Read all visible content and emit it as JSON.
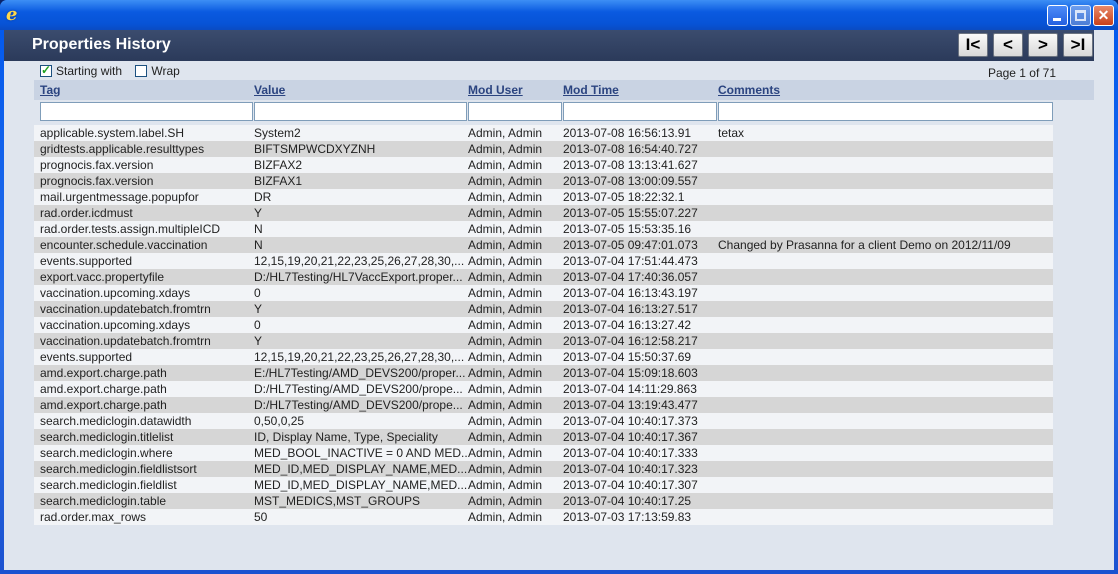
{
  "window": {
    "icon": "ie-icon"
  },
  "header": {
    "title": "Properties History"
  },
  "nav": {
    "first": "I<",
    "prev": "<",
    "next": ">",
    "last": ">I"
  },
  "options": {
    "starting_with": {
      "label": "Starting with",
      "checked": true
    },
    "wrap": {
      "label": "Wrap",
      "checked": false
    },
    "page_indicator": "Page 1 of 71"
  },
  "columns": [
    "Tag",
    "Value",
    "Mod User",
    "Mod Time",
    "Comments"
  ],
  "filters": {
    "tag": "",
    "value": "",
    "mod_user": "",
    "mod_time": "",
    "comments": ""
  },
  "rows": [
    {
      "tag": "applicable.system.label.SH",
      "value": "System2",
      "user": "Admin, Admin",
      "time": "2013-07-08 16:56:13.91",
      "comment": "tetax"
    },
    {
      "tag": "gridtests.applicable.resulttypes",
      "value": "BIFTSMPWCDXYZNH",
      "user": "Admin, Admin",
      "time": "2013-07-08 16:54:40.727",
      "comment": ""
    },
    {
      "tag": "prognocis.fax.version",
      "value": "BIZFAX2",
      "user": "Admin, Admin",
      "time": "2013-07-08 13:13:41.627",
      "comment": ""
    },
    {
      "tag": "prognocis.fax.version",
      "value": "BIZFAX1",
      "user": "Admin, Admin",
      "time": "2013-07-08 13:00:09.557",
      "comment": ""
    },
    {
      "tag": "mail.urgentmessage.popupfor",
      "value": "DR",
      "user": "Admin, Admin",
      "time": "2013-07-05 18:22:32.1",
      "comment": ""
    },
    {
      "tag": "rad.order.icdmust",
      "value": "Y",
      "user": "Admin, Admin",
      "time": "2013-07-05 15:55:07.227",
      "comment": ""
    },
    {
      "tag": "rad.order.tests.assign.multipleICD",
      "value": "N",
      "user": "Admin, Admin",
      "time": "2013-07-05 15:53:35.16",
      "comment": ""
    },
    {
      "tag": "encounter.schedule.vaccination",
      "value": "N",
      "user": "Admin, Admin",
      "time": "2013-07-05 09:47:01.073",
      "comment": "Changed by Prasanna for a client Demo on 2012/11/09"
    },
    {
      "tag": "events.supported",
      "value": "12,15,19,20,21,22,23,25,26,27,28,30,...",
      "user": "Admin, Admin",
      "time": "2013-07-04 17:51:44.473",
      "comment": ""
    },
    {
      "tag": "export.vacc.propertyfile",
      "value": "D:/HL7Testing/HL7VaccExport.proper...",
      "user": "Admin, Admin",
      "time": "2013-07-04 17:40:36.057",
      "comment": ""
    },
    {
      "tag": "vaccination.upcoming.xdays",
      "value": "0",
      "user": "Admin, Admin",
      "time": "2013-07-04 16:13:43.197",
      "comment": ""
    },
    {
      "tag": "vaccination.updatebatch.fromtrn",
      "value": "Y",
      "user": "Admin, Admin",
      "time": "2013-07-04 16:13:27.517",
      "comment": ""
    },
    {
      "tag": "vaccination.upcoming.xdays",
      "value": "0",
      "user": "Admin, Admin",
      "time": "2013-07-04 16:13:27.42",
      "comment": ""
    },
    {
      "tag": "vaccination.updatebatch.fromtrn",
      "value": "Y",
      "user": "Admin, Admin",
      "time": "2013-07-04 16:12:58.217",
      "comment": ""
    },
    {
      "tag": "events.supported",
      "value": "12,15,19,20,21,22,23,25,26,27,28,30,...",
      "user": "Admin, Admin",
      "time": "2013-07-04 15:50:37.69",
      "comment": ""
    },
    {
      "tag": "amd.export.charge.path",
      "value": "E:/HL7Testing/AMD_DEVS200/proper...",
      "user": "Admin, Admin",
      "time": "2013-07-04 15:09:18.603",
      "comment": ""
    },
    {
      "tag": "amd.export.charge.path",
      "value": "D:/HL7Testing/AMD_DEVS200/prope...",
      "user": "Admin, Admin",
      "time": "2013-07-04 14:11:29.863",
      "comment": ""
    },
    {
      "tag": "amd.export.charge.path",
      "value": "D:/HL7Testing/AMD_DEVS200/prope...",
      "user": "Admin, Admin",
      "time": "2013-07-04 13:19:43.477",
      "comment": ""
    },
    {
      "tag": "search.mediclogin.datawidth",
      "value": "0,50,0,25",
      "user": "Admin, Admin",
      "time": "2013-07-04 10:40:17.373",
      "comment": ""
    },
    {
      "tag": "search.mediclogin.titlelist",
      "value": "ID, Display Name, Type, Speciality",
      "user": "Admin, Admin",
      "time": "2013-07-04 10:40:17.367",
      "comment": ""
    },
    {
      "tag": "search.mediclogin.where",
      "value": "MED_BOOL_INACTIVE = 0 AND MED...",
      "user": "Admin, Admin",
      "time": "2013-07-04 10:40:17.333",
      "comment": ""
    },
    {
      "tag": "search.mediclogin.fieldlistsort",
      "value": "MED_ID,MED_DISPLAY_NAME,MED...",
      "user": "Admin, Admin",
      "time": "2013-07-04 10:40:17.323",
      "comment": ""
    },
    {
      "tag": "search.mediclogin.fieldlist",
      "value": "MED_ID,MED_DISPLAY_NAME,MED...",
      "user": "Admin, Admin",
      "time": "2013-07-04 10:40:17.307",
      "comment": ""
    },
    {
      "tag": "search.mediclogin.table",
      "value": "MST_MEDICS,MST_GROUPS",
      "user": "Admin, Admin",
      "time": "2013-07-04 10:40:17.25",
      "comment": ""
    },
    {
      "tag": "rad.order.max_rows",
      "value": "50",
      "user": "Admin, Admin",
      "time": "2013-07-03 17:13:59.83",
      "comment": ""
    }
  ]
}
